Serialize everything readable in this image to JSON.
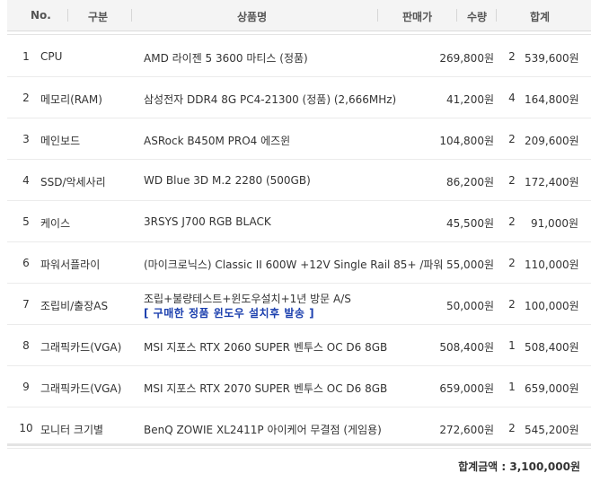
{
  "header": {
    "no": "No.",
    "category": "구분",
    "product": "상품명",
    "price": "판매가",
    "qty": "수량",
    "total": "합계"
  },
  "rows": [
    {
      "no": "1",
      "category": "CPU",
      "product": "AMD 라이젠 5 3600 마티스 (정품)",
      "price": "269,800원",
      "qty": "2",
      "total": "539,600원"
    },
    {
      "no": "2",
      "category": "메모리(RAM)",
      "product": "삼성전자 DDR4 8G PC4-21300 (정품) (2,666MHz)",
      "price": "41,200원",
      "qty": "4",
      "total": "164,800원"
    },
    {
      "no": "3",
      "category": "메인보드",
      "product": "ASRock B450M PRO4 에즈윈",
      "price": "104,800원",
      "qty": "2",
      "total": "209,600원"
    },
    {
      "no": "4",
      "category": "SSD/악세사리",
      "product": "WD Blue 3D M.2 2280 (500GB)",
      "price": "86,200원",
      "qty": "2",
      "total": "172,400원"
    },
    {
      "no": "5",
      "category": "케이스",
      "product": "3RSYS J700 RGB BLACK",
      "price": "45,500원",
      "qty": "2",
      "total": "91,000원"
    },
    {
      "no": "6",
      "category": "파워서플라이",
      "product": "(마이크로닉스) Classic II 600W +12V Single Rail 85+ /파워",
      "price": "55,000원",
      "qty": "2",
      "total": "110,000원"
    },
    {
      "no": "7",
      "category": "조립비/출장AS",
      "product": "조립+불량테스트+윈도우설치+1년 방문 A/S",
      "note": "[ 구매한 정품 윈도우 설치후 발송 ]",
      "price": "50,000원",
      "qty": "2",
      "total": "100,000원"
    },
    {
      "no": "8",
      "category": "그래픽카드(VGA)",
      "product": "MSI 지포스 RTX 2060 SUPER 벤투스 OC D6 8GB",
      "price": "508,400원",
      "qty": "1",
      "total": "508,400원"
    },
    {
      "no": "9",
      "category": "그래픽카드(VGA)",
      "product": "MSI 지포스 RTX 2070 SUPER 벤투스 OC D6 8GB",
      "price": "659,000원",
      "qty": "1",
      "total": "659,000원"
    },
    {
      "no": "10",
      "category": "모니터 크기별",
      "product": "BenQ ZOWIE XL2411P 아이케어 무결점 (게임용)",
      "price": "272,600원",
      "qty": "2",
      "total": "545,200원"
    }
  ],
  "summary": {
    "grand_total_label": "합계금액 :",
    "grand_total_value": "3,100,000원"
  },
  "colors": {
    "note": "#1b3fae",
    "header_bg": "#f4f4f4"
  }
}
